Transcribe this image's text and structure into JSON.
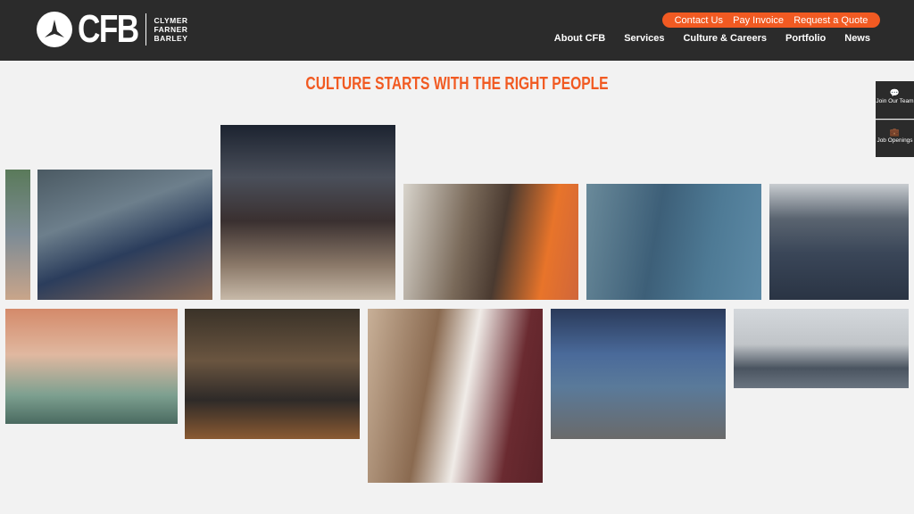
{
  "header": {
    "logo": {
      "mark": "CFB",
      "words": [
        "CLYMER",
        "FARNER",
        "BARLEY"
      ]
    },
    "utility_links": [
      "Contact Us",
      "Pay Invoice",
      "Request a Quote"
    ],
    "nav": [
      "About CFB",
      "Services",
      "Culture & Careers",
      "Portfolio",
      "News"
    ]
  },
  "main": {
    "title": "CULTURE STARTS WITH THE RIGHT PEOPLE"
  },
  "side_tabs": [
    {
      "label": "Join Our Team",
      "icon": "chat-icon"
    },
    {
      "label": "Job Openings",
      "icon": "briefcase-icon"
    }
  ],
  "colors": {
    "accent": "#f15a22",
    "header_bg": "#2b2b2b",
    "page_bg": "#f2f2f2"
  },
  "photos": [
    "stadium-crowd-partial",
    "stadium-group",
    "three-women-night",
    "cookout-grill",
    "team-hard-hats",
    "bus-group",
    "office-party",
    "restaurant-group",
    "three-people-selfie",
    "vault-group",
    "team-in-office"
  ]
}
